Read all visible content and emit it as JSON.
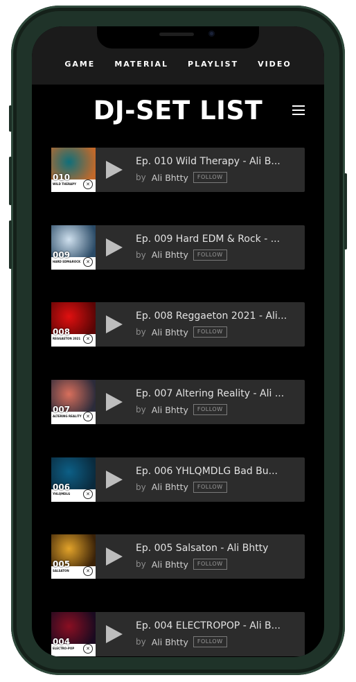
{
  "nav": {
    "items": [
      {
        "label": "GAME"
      },
      {
        "label": "MATERIAL"
      },
      {
        "label": "PLAYLIST"
      },
      {
        "label": "VIDEO"
      }
    ]
  },
  "header": {
    "title": "DJ-SET LIST",
    "menu_icon": "hamburger-menu-icon"
  },
  "tracks": [
    {
      "num": "010",
      "cover_subtitle": "WILD THERAPY",
      "title": "Ep. 010 Wild Therapy - Ali B...",
      "by": "by",
      "artist": "Ali Bhtty",
      "follow": "FOLLOW",
      "cover_colors": [
        "#0f6f7a",
        "#c2692a"
      ]
    },
    {
      "num": "009",
      "cover_subtitle": "HARD EDM&ROCK",
      "title": "Ep. 009 Hard EDM & Rock - ...",
      "by": "by",
      "artist": "Ali Bhtty",
      "follow": "FOLLOW",
      "cover_colors": [
        "#cfe0ee",
        "#2a4a66"
      ]
    },
    {
      "num": "008",
      "cover_subtitle": "REGGAETON 2021",
      "title": "Ep. 008 Reggaeton 2021 - Ali...",
      "by": "by",
      "artist": "Ali Bhtty",
      "follow": "FOLLOW",
      "cover_colors": [
        "#e01010",
        "#5a0505"
      ]
    },
    {
      "num": "007",
      "cover_subtitle": "ALTERING REALITY",
      "title": "Ep. 007 Altering Reality - Ali ...",
      "by": "by",
      "artist": "Ali Bhtty",
      "follow": "FOLLOW",
      "cover_colors": [
        "#d86f5c",
        "#2b2b3a"
      ]
    },
    {
      "num": "006",
      "cover_subtitle": "YHLQMDLG",
      "title": "Ep. 006 YHLQMDLG Bad Bu...",
      "by": "by",
      "artist": "Ali Bhtty",
      "follow": "FOLLOW",
      "cover_colors": [
        "#0d5f86",
        "#0a2a3d"
      ]
    },
    {
      "num": "005",
      "cover_subtitle": "SALSATON",
      "title": "Ep. 005 Salsaton - Ali Bhtty",
      "by": "by",
      "artist": "Ali Bhtty",
      "follow": "FOLLOW",
      "cover_colors": [
        "#e2a32a",
        "#3a2208"
      ]
    },
    {
      "num": "004",
      "cover_subtitle": "ELECTRO-POP",
      "title": "Ep. 004 ELECTROPOP - Ali B...",
      "by": "by",
      "artist": "Ali Bhtty",
      "follow": "FOLLOW",
      "cover_colors": [
        "#8a0f22",
        "#1a0a20"
      ]
    }
  ],
  "colors": {
    "frame": "#1f3329",
    "screen_bg": "#000000",
    "topbar_bg": "#1b1b1b",
    "card_bg": "#2c2c2c",
    "play_icon": "#bdbdbd",
    "text_primary": "#e2e2e2",
    "text_muted": "#8d8d8d"
  }
}
